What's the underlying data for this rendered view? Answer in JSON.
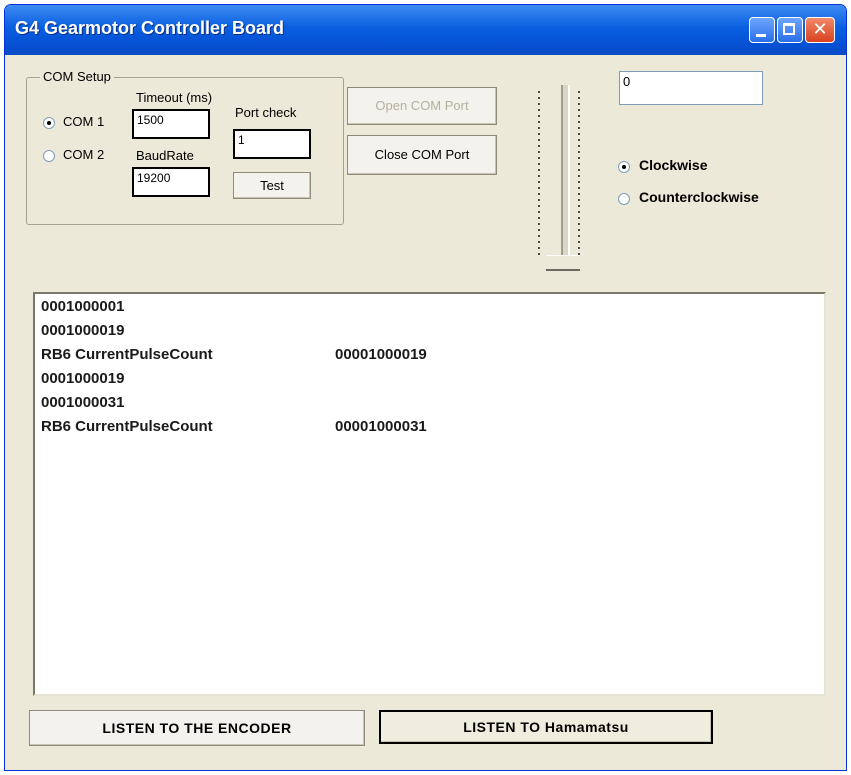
{
  "window": {
    "title": "G4 Gearmotor Controller Board",
    "close_glyph": "✕"
  },
  "com_setup": {
    "group_label": "COM Setup",
    "com1_label": "COM 1",
    "com2_label": "COM 2",
    "selected_port": "COM 1",
    "timeout_label": "Timeout (ms)",
    "timeout_value": "1500",
    "baudrate_label": "BaudRate",
    "baudrate_value": "19200",
    "port_check_label": "Port check",
    "port_check_value": "1",
    "test_button": "Test"
  },
  "port_buttons": {
    "open_label": "Open COM Port",
    "open_enabled": false,
    "close_label": "Close COM Port"
  },
  "position_field": {
    "value": "0"
  },
  "slider": {
    "level": 0
  },
  "direction": {
    "clockwise_label": "Clockwise",
    "counterclockwise_label": "Counterclockwise",
    "selected": "Clockwise"
  },
  "log": {
    "lines": [
      {
        "text": "0001000001",
        "value": ""
      },
      {
        "text": "0001000019",
        "value": ""
      },
      {
        "text": "RB6 CurrentPulseCount",
        "value": "00001000019"
      },
      {
        "text": "0001000019",
        "value": ""
      },
      {
        "text": "0001000031",
        "value": ""
      },
      {
        "text": "RB6 CurrentPulseCount",
        "value": "00001000031"
      }
    ]
  },
  "bottom_buttons": {
    "encoder_label": "LISTEN TO THE ENCODER",
    "hamamatsu_label": "LISTEN TO Hamamatsu"
  },
  "icons": {
    "minimize": "minimize-icon",
    "maximize": "maximize-icon",
    "close": "close-icon"
  },
  "colors": {
    "titlebar": "#0a5fe0",
    "window_bg": "#ece9d8"
  }
}
